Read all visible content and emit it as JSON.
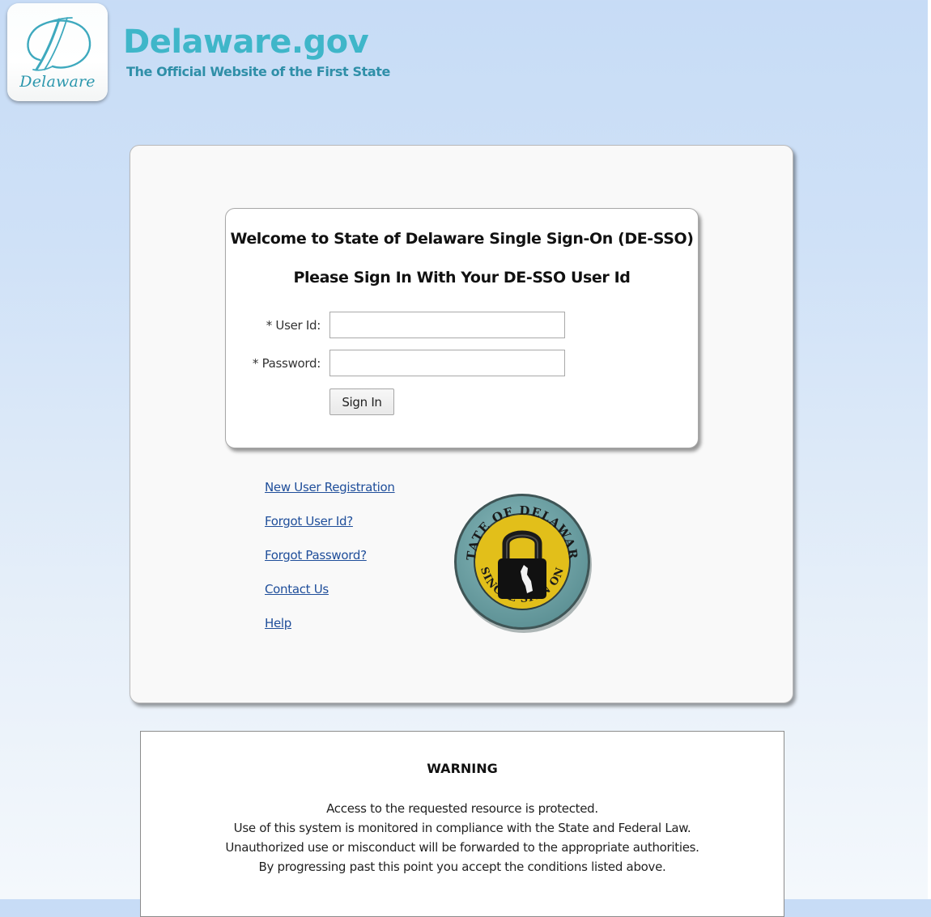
{
  "header": {
    "logo_word": "Delaware",
    "site_title": "Delaware.gov",
    "tagline": "The Official Website of the First State"
  },
  "login": {
    "welcome_title": "Welcome to State of Delaware Single Sign-On (DE-SSO)",
    "subtitle": "Please Sign In With Your DE-SSO User Id",
    "user_id_label": "* User Id:",
    "user_id_value": "",
    "password_label": "* Password:",
    "password_value": "",
    "signin_label": "Sign In"
  },
  "links": [
    {
      "label": "New User Registration"
    },
    {
      "label": "Forgot User Id?"
    },
    {
      "label": "Forgot Password?"
    },
    {
      "label": "Contact Us"
    },
    {
      "label": "Help"
    }
  ],
  "seal": {
    "icon": "padlock-seal-icon",
    "top_text": "STATE OF DELAWARE",
    "bottom_text": "SINGLE SIGN ON"
  },
  "warning": {
    "title": "WARNING",
    "lines": [
      "Access to the requested resource is protected.",
      "Use of this system is monitored in compliance with the State and Federal Law.",
      "Unauthorized use or misconduct will be forwarded to the appropriate authorities.",
      "By progressing past this point you accept the conditions listed above."
    ]
  },
  "colors": {
    "brand_teal": "#3fb6c9",
    "link_blue": "#1f4e9a",
    "seal_ring": "#6aa3a6",
    "seal_gold": "#e2bf1a"
  }
}
